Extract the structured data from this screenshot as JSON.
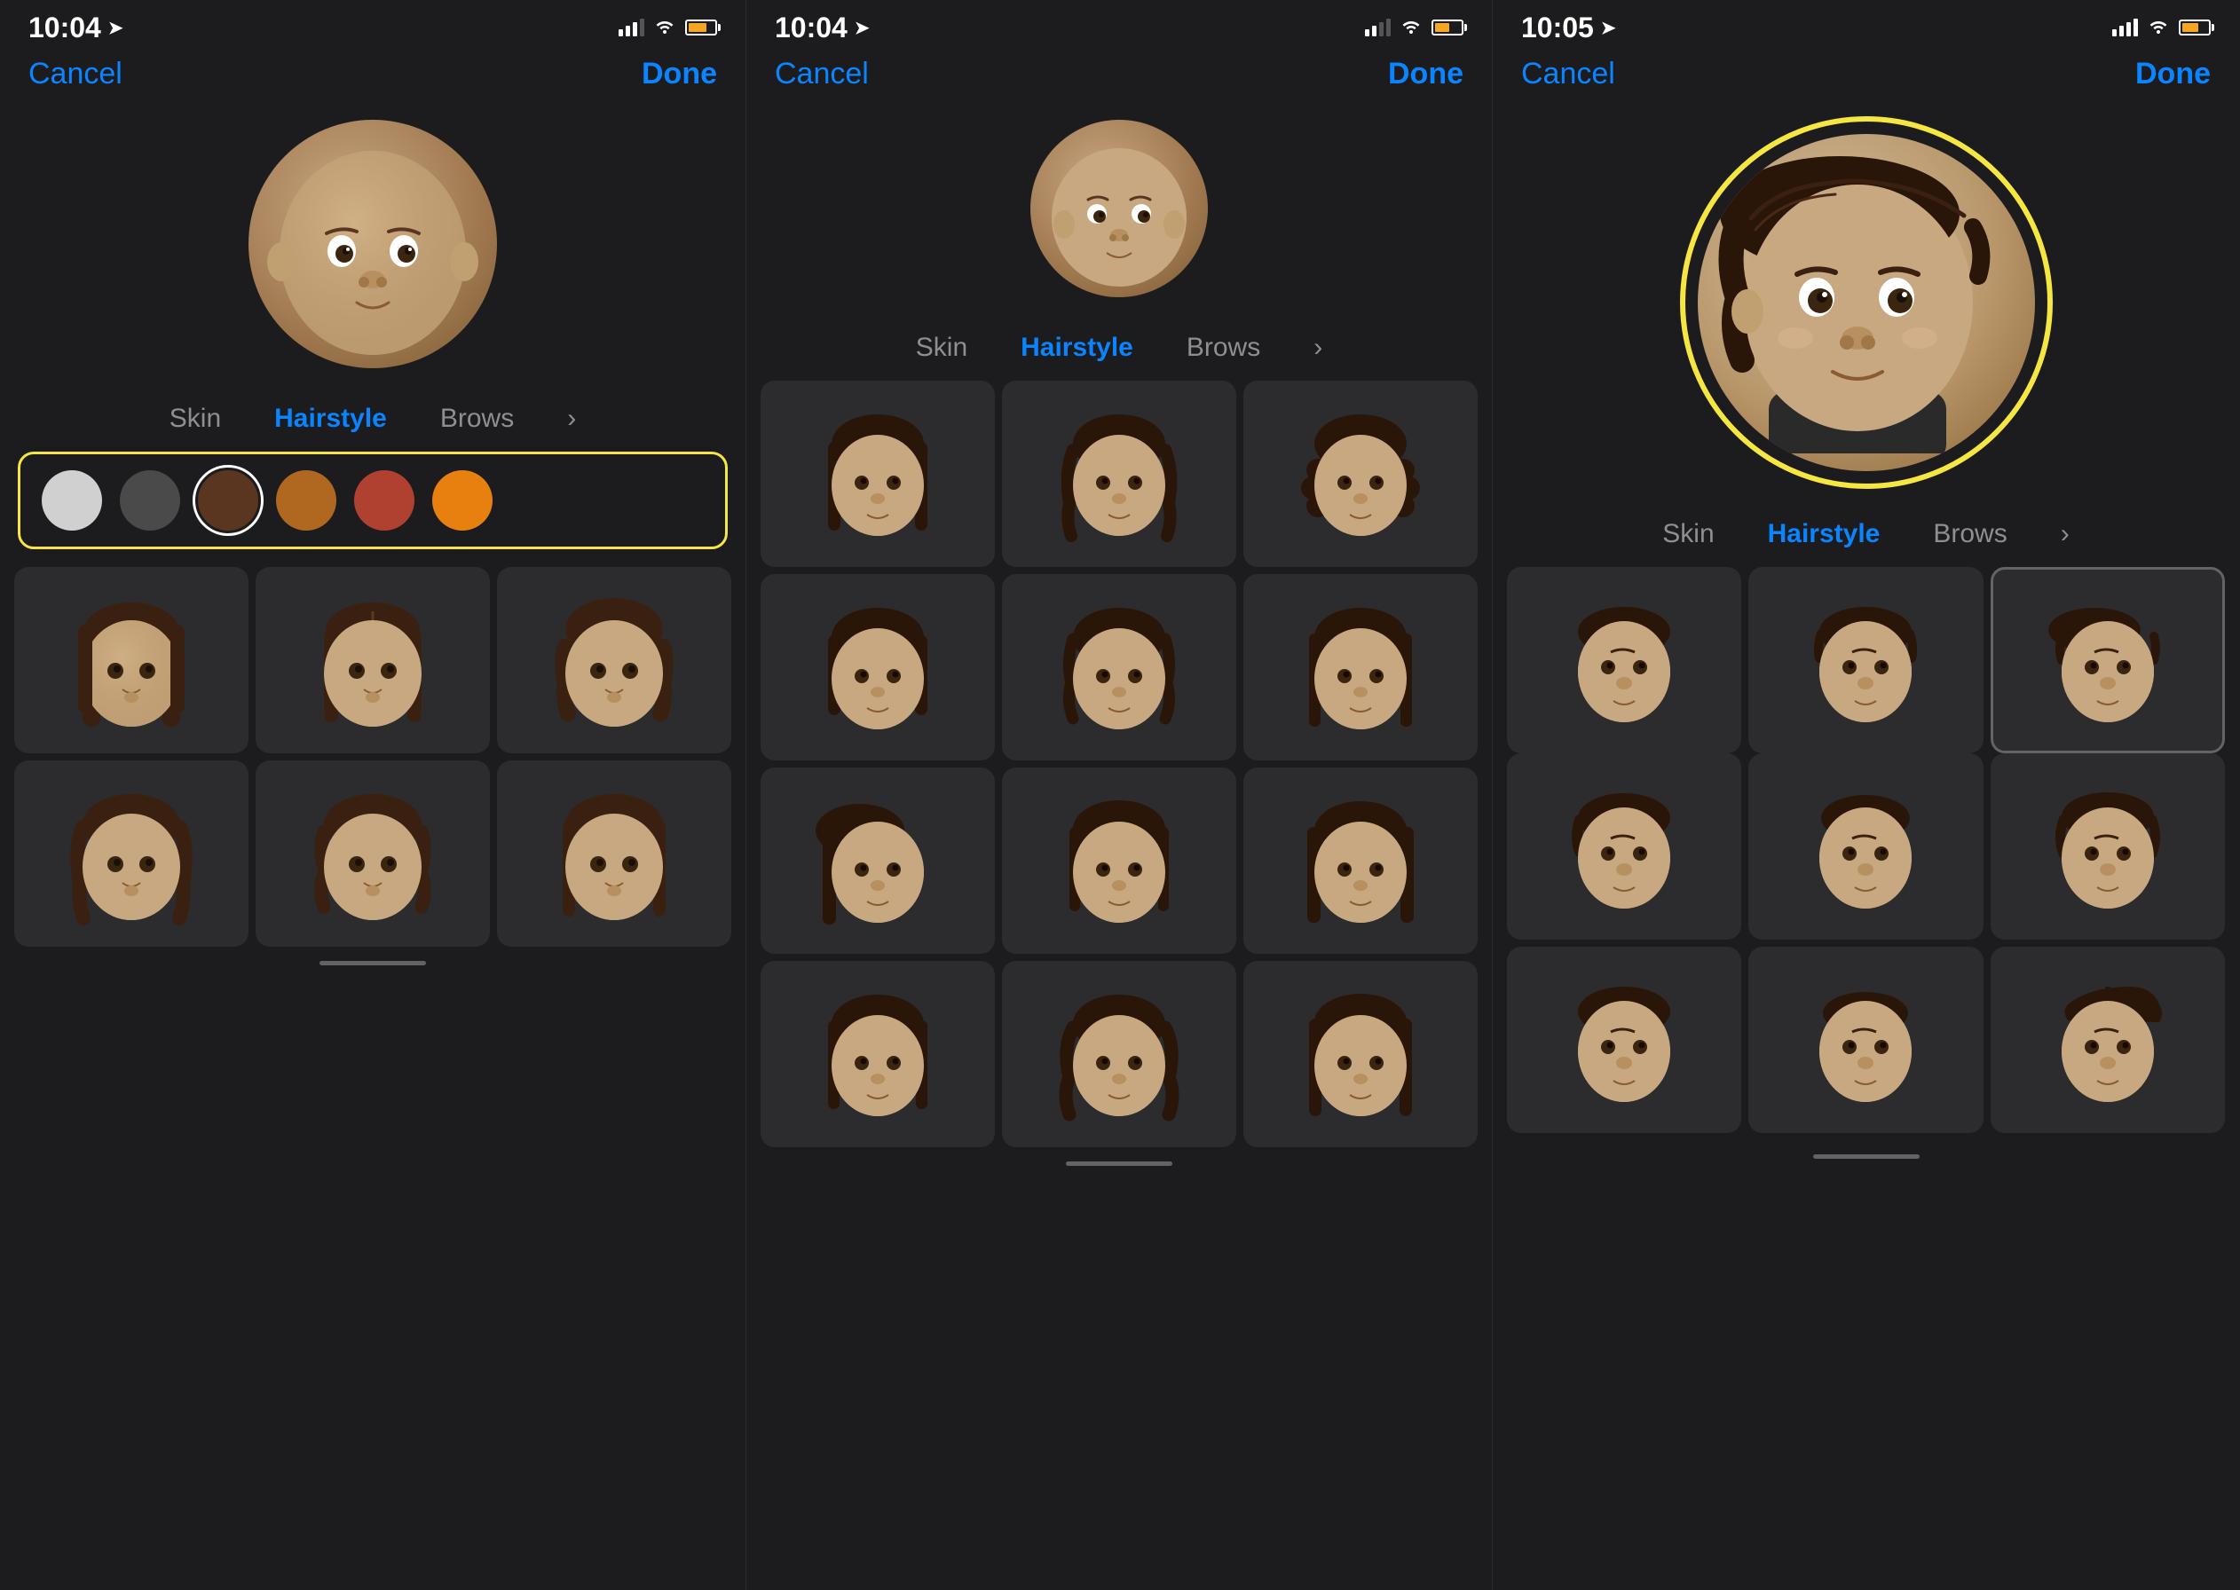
{
  "panels": [
    {
      "id": "panel1",
      "statusBar": {
        "time": "10:04",
        "hasLocation": true,
        "batteryColor": "#f5a623",
        "batteryLevel": 60
      },
      "nav": {
        "cancel": "Cancel",
        "done": "Done"
      },
      "tabs": [
        {
          "label": "Skin",
          "active": false
        },
        {
          "label": "Hairstyle",
          "active": true
        },
        {
          "label": "Brows",
          "active": false
        }
      ],
      "colorSwatches": [
        {
          "color": "#d0d0d0",
          "selected": false
        },
        {
          "color": "#4a4a4a",
          "selected": false
        },
        {
          "color": "#5a3520",
          "selected": true
        },
        {
          "color": "#b06820",
          "selected": false
        },
        {
          "color": "#b04030",
          "selected": false
        },
        {
          "color": "#e88010",
          "selected": false
        }
      ],
      "hairstyles": [
        {
          "type": "long-straight",
          "dark": true
        },
        {
          "type": "long-center-part",
          "dark": true
        },
        {
          "type": "long-wavy",
          "dark": true
        },
        {
          "type": "long-side-part",
          "dark": true
        },
        {
          "type": "medium-wavy",
          "dark": true
        },
        {
          "type": "long-layered",
          "dark": true
        }
      ]
    },
    {
      "id": "panel2",
      "statusBar": {
        "time": "10:04",
        "hasLocation": true,
        "batteryColor": "#f5a623",
        "batteryLevel": 50
      },
      "nav": {
        "cancel": "Cancel",
        "done": "Done"
      },
      "tabs": [
        {
          "label": "Skin",
          "active": false
        },
        {
          "label": "Hairstyle",
          "active": true
        },
        {
          "label": "Brows",
          "active": false
        }
      ],
      "hairstyles": [
        {
          "type": "long-straight-2"
        },
        {
          "type": "long-curly"
        },
        {
          "type": "long-curly-2"
        },
        {
          "type": "medium-straight"
        },
        {
          "type": "long-layered-2"
        },
        {
          "type": "medium-wavy-2"
        },
        {
          "type": "long-dark"
        },
        {
          "type": "long-shiny"
        },
        {
          "type": "long-dark-2"
        },
        {
          "type": "medium-textured"
        },
        {
          "type": "braided"
        },
        {
          "type": "long-dark-3"
        }
      ]
    },
    {
      "id": "panel3",
      "statusBar": {
        "time": "10:05",
        "hasLocation": true,
        "batteryColor": "#f5a623",
        "batteryLevel": 55
      },
      "nav": {
        "cancel": "Cancel",
        "done": "Done"
      },
      "tabs": [
        {
          "label": "Skin",
          "active": false
        },
        {
          "label": "Hairstyle",
          "active": true
        },
        {
          "label": "Brows",
          "active": false
        }
      ],
      "hairstyles": [
        {
          "type": "short-side-part",
          "selected": false
        },
        {
          "type": "short-classic",
          "selected": false
        },
        {
          "type": "short-pompadour",
          "selected": true
        },
        {
          "type": "short-spiky",
          "selected": false
        },
        {
          "type": "short-curly-male",
          "selected": false
        },
        {
          "type": "short-textured",
          "selected": false
        },
        {
          "type": "short-wavy-male",
          "selected": false
        },
        {
          "type": "short-buzz",
          "selected": false
        },
        {
          "type": "short-mohawk",
          "selected": false
        }
      ]
    }
  ],
  "icons": {
    "location": "➤",
    "wifi": "▲",
    "battery": "▐"
  }
}
